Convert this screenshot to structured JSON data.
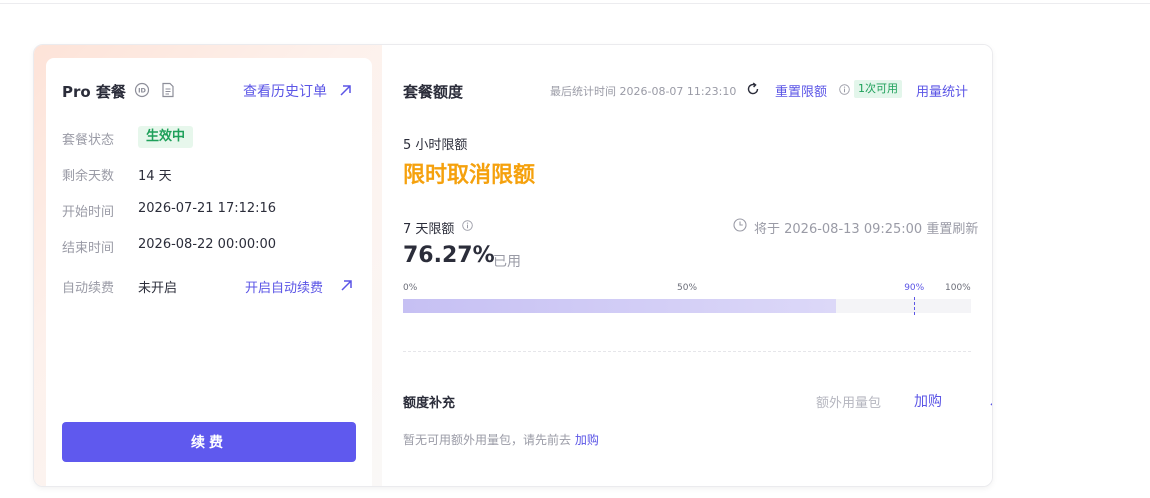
{
  "plan": {
    "title": "Pro 套餐",
    "history_link": "查看历史订单",
    "rows": [
      {
        "label": "套餐状态",
        "value": "生效中"
      },
      {
        "label": "剩余天数",
        "value": "14 天"
      },
      {
        "label": "开始时间",
        "value": "2026-07-21 17:12:16"
      },
      {
        "label": "结束时间",
        "value": "2026-08-22 00:00:00"
      },
      {
        "label": "自动续费",
        "value": "未开启"
      }
    ],
    "autorenew_link": "开启自动续费",
    "renew_button": "续费"
  },
  "quota": {
    "title": "套餐额度",
    "stat_time": "最后统计时间 2026-08-07 11:23:10",
    "reset_link": "重置限额",
    "available_badge": "1次可用",
    "usage_link": "用量统计",
    "five_hour": {
      "label": "5 小时限额",
      "value": "限时取消限额"
    },
    "seven_day": {
      "label": "7 天限额",
      "reset_time": "将于 2026-08-13 09:25:00 重置刷新",
      "used_percent": "76.27%",
      "used_label": "已用",
      "progress": 0.7627,
      "threshold": 0.9,
      "ticks": [
        {
          "label": "0%",
          "pos": 0
        },
        {
          "label": "50%",
          "pos": 0.5
        },
        {
          "label": "90%",
          "pos": 0.9
        },
        {
          "label": "100%",
          "pos": 1
        }
      ]
    }
  },
  "supplement": {
    "title": "额度补充",
    "extra_tab": "额外用量包",
    "buy_link": "加购",
    "empty_text": "暂无可用额外用量包，请先前去",
    "empty_link": "加购"
  },
  "colors": {
    "accent": "#5f59ee",
    "link": "#5b55e6",
    "success": "#1ea05a",
    "warning": "#f5a10d"
  }
}
